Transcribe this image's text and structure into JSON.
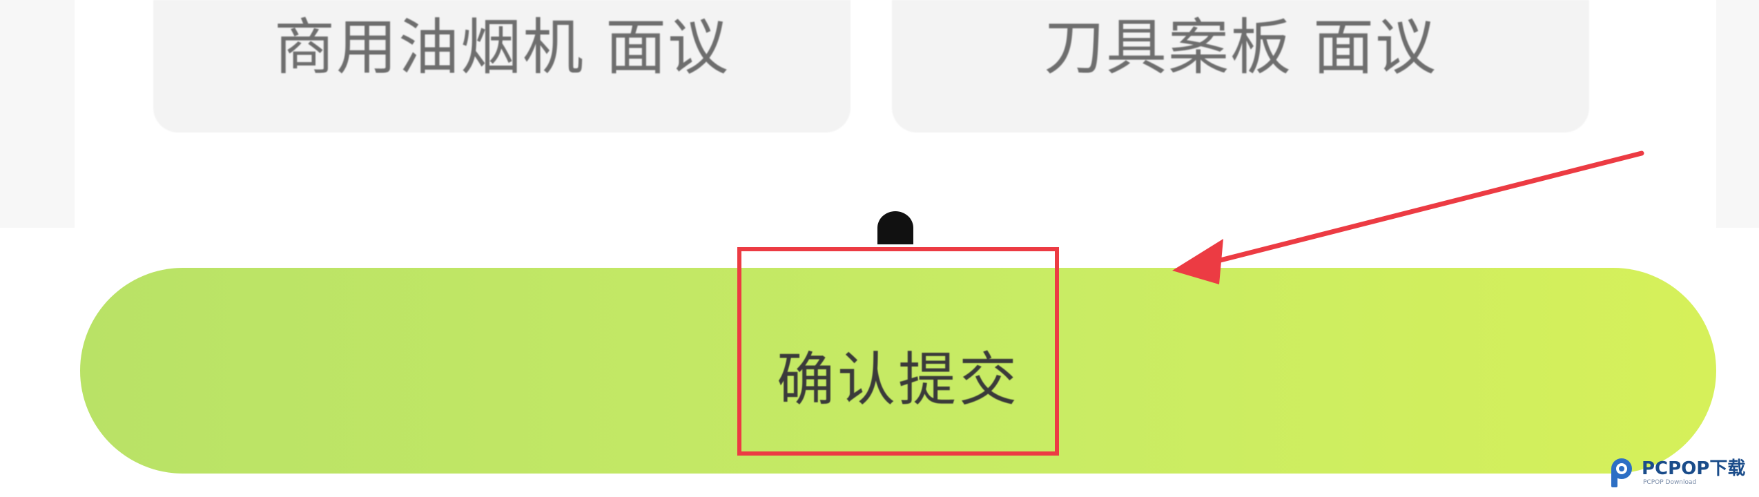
{
  "options": [
    {
      "label": "商用油烟机 面议"
    },
    {
      "label": "刀具案板 面议"
    }
  ],
  "submit": {
    "label": "确认提交"
  },
  "annotation": {
    "color": "#ec3b43"
  },
  "button_gradient": [
    "#b9e266",
    "#d6f05a"
  ],
  "watermark": {
    "brand": "PCPOP下载",
    "subtitle": "PCPOP Download",
    "logo_icon": "pcpop-logo-icon"
  }
}
